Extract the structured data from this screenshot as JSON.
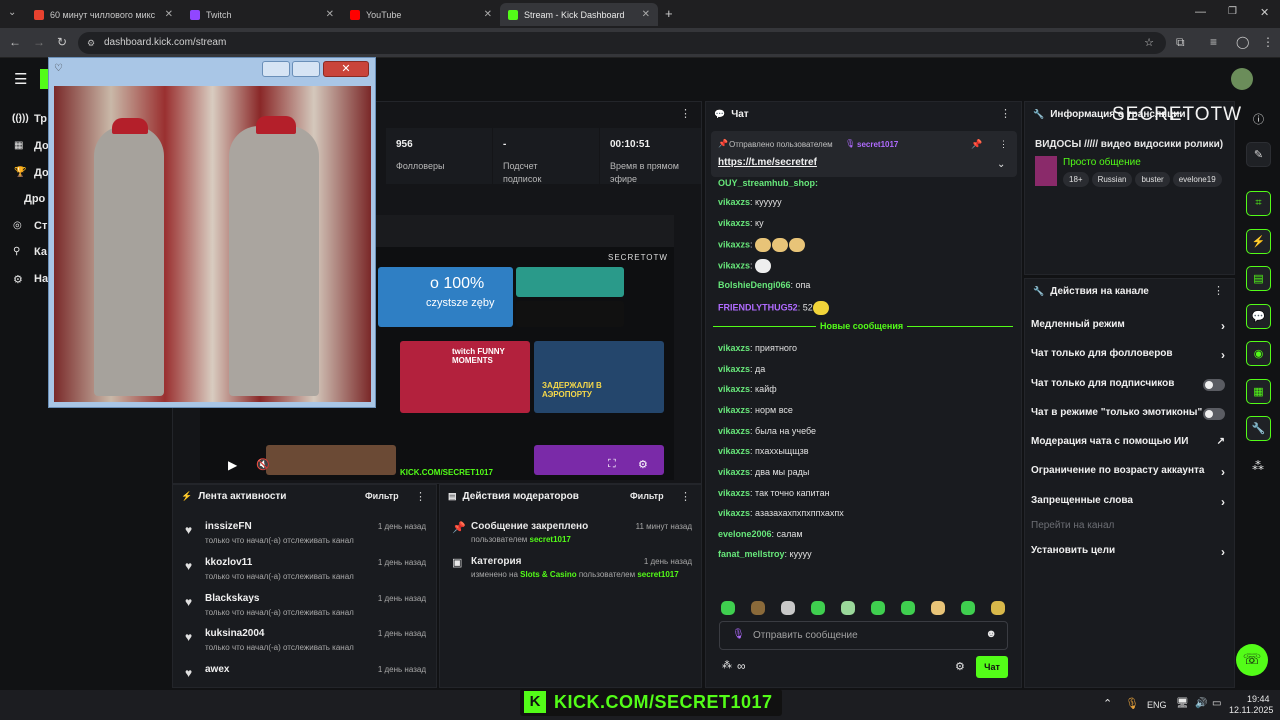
{
  "browser": {
    "tabs": [
      {
        "label": "60 минут чиллового микс",
        "active": false
      },
      {
        "label": "Twitch",
        "active": false
      },
      {
        "label": "YouTube",
        "active": false
      },
      {
        "label": "Stream - Kick Dashboard",
        "active": true
      }
    ],
    "url": "dashboard.kick.com/stream"
  },
  "sidebar": {
    "items": [
      {
        "label": "Тр",
        "icon": "broadcast-icon"
      },
      {
        "label": "До",
        "icon": "dashboard-icon"
      },
      {
        "label": "До",
        "icon": "trophy-icon"
      },
      {
        "label": "Дро",
        "icon": "drops-icon"
      },
      {
        "label": "Ст",
        "icon": "stream-icon"
      },
      {
        "label": "Ка",
        "icon": "channel-icon"
      },
      {
        "label": "На",
        "icon": "settings-icon"
      }
    ]
  },
  "stats": [
    {
      "value": "956",
      "label": "Фолловеры"
    },
    {
      "value": "-",
      "label": "Подсчет подписок"
    },
    {
      "value": "00:10:51",
      "label": "Время в прямом эфире"
    }
  ],
  "preview": {
    "channel_watermark": "SECRETOTW",
    "ad_text_1": "o 100%",
    "ad_text_2": "czystsze zęby",
    "thumb_1": "twitch FUNNY MOMENTS",
    "thumb_2": "ЗАДЕРЖАЛИ В АЭРОПОРТУ",
    "bottom_url": "KICK.COM/SECRET1017"
  },
  "activity": {
    "title": "Лента активности",
    "filter": "Фильтр",
    "items": [
      {
        "name": "inssizeFN",
        "sub": "только что начал(-а) отслеживать канал",
        "time": "1 день назад"
      },
      {
        "name": "kkozlov11",
        "sub": "только что начал(-а) отслеживать канал",
        "time": "1 день назад"
      },
      {
        "name": "Blackskays",
        "sub": "только что начал(-а) отслеживать канал",
        "time": "1 день назад"
      },
      {
        "name": "kuksina2004",
        "sub": "только что начал(-а) отслеживать канал",
        "time": "1 день назад"
      },
      {
        "name": "awex",
        "sub": "",
        "time": "1 день назад"
      }
    ]
  },
  "mod_actions": {
    "title": "Действия модераторов",
    "filter": "Фильтр",
    "items": [
      {
        "title": "Сообщение закреплено",
        "time": "11 минут назад",
        "pre": "пользователем ",
        "user": "secret1017"
      },
      {
        "title": "Категория",
        "time": "1 день назад",
        "pre": "изменено на ",
        "category": "Slots & Casino",
        "mid": " пользователем ",
        "user": "secret1017"
      }
    ]
  },
  "chat": {
    "title": "Чат",
    "pinned_by_label": "Отправлено пользователем",
    "pinned_user": "secret1017",
    "pinned_link": "https://t.me/secretref",
    "cut_line": "OUY_streamhub_shop:",
    "messages_before": [
      {
        "user": "vikaxzs",
        "text": "кууууу"
      },
      {
        "user": "vikaxzs",
        "text": "ку"
      },
      {
        "user": "vikaxzs",
        "text": ""
      },
      {
        "user": "vikaxzs",
        "text": ""
      },
      {
        "user": "BolshieDengi066",
        "text": "опа"
      },
      {
        "user": "FRIENDLYTHUG52",
        "text": "52"
      }
    ],
    "new_messages_label": "Новые сообщения",
    "messages_after": [
      {
        "user": "vikaxzs",
        "text": "приятного"
      },
      {
        "user": "vikaxzs",
        "text": "да"
      },
      {
        "user": "vikaxzs",
        "text": "кайф"
      },
      {
        "user": "vikaxzs",
        "text": "норм все"
      },
      {
        "user": "vikaxzs",
        "text": "была на учебе"
      },
      {
        "user": "vikaxzs",
        "text": "пхаххыщщзв"
      },
      {
        "user": "vikaxzs",
        "text": "два мы рады"
      },
      {
        "user": "vikaxzs",
        "text": "так точно капитан"
      },
      {
        "user": "vikaxzs",
        "text": "азазахахпхпхппхахпх"
      },
      {
        "user": "evelone2006",
        "text": "салам"
      },
      {
        "user": "fanat_mellstroy",
        "text": "кууyy"
      }
    ],
    "input_placeholder": "Отправить сообщение",
    "send_label": "Чат",
    "infinity_label": "∞"
  },
  "stream_info": {
    "title": "Информация о трансляции",
    "stream_title": "ВИДОСЫ ///// видео видосики ролики)",
    "category": "Просто общение",
    "tags": [
      "18+",
      "Russian",
      "buster",
      "evelone19"
    ],
    "watermark": "SECRETOTW"
  },
  "channel_actions": {
    "title": "Действия на канале",
    "items": [
      {
        "label": "Медленный режим",
        "control": "arrow"
      },
      {
        "label": "Чат только для фолловеров",
        "control": "arrow"
      },
      {
        "label": "Чат только для подписчиков",
        "control": "toggle"
      },
      {
        "label": "Чат в режиме \"только эмотиконы\"",
        "control": "toggle"
      },
      {
        "label": "Модерация чата с помощью ИИ",
        "control": "external"
      },
      {
        "label": "Ограничение по возрасту аккаунта",
        "control": "arrow"
      },
      {
        "label": "Запрещенные слова",
        "control": "arrow"
      },
      {
        "label": "Перейти на канал",
        "control": "none"
      },
      {
        "label": "Установить цели",
        "control": "arrow"
      }
    ]
  },
  "overlay": {
    "banner": "KICK.COM/SECRET1017",
    "banner_logo": "K"
  },
  "taskbar": {
    "lang": "ENG",
    "time": "19:44",
    "date": "12.11.2025"
  },
  "colors": {
    "accent": "#53fc18",
    "username": "#67e67a",
    "pinned_user": "#b06bff"
  }
}
